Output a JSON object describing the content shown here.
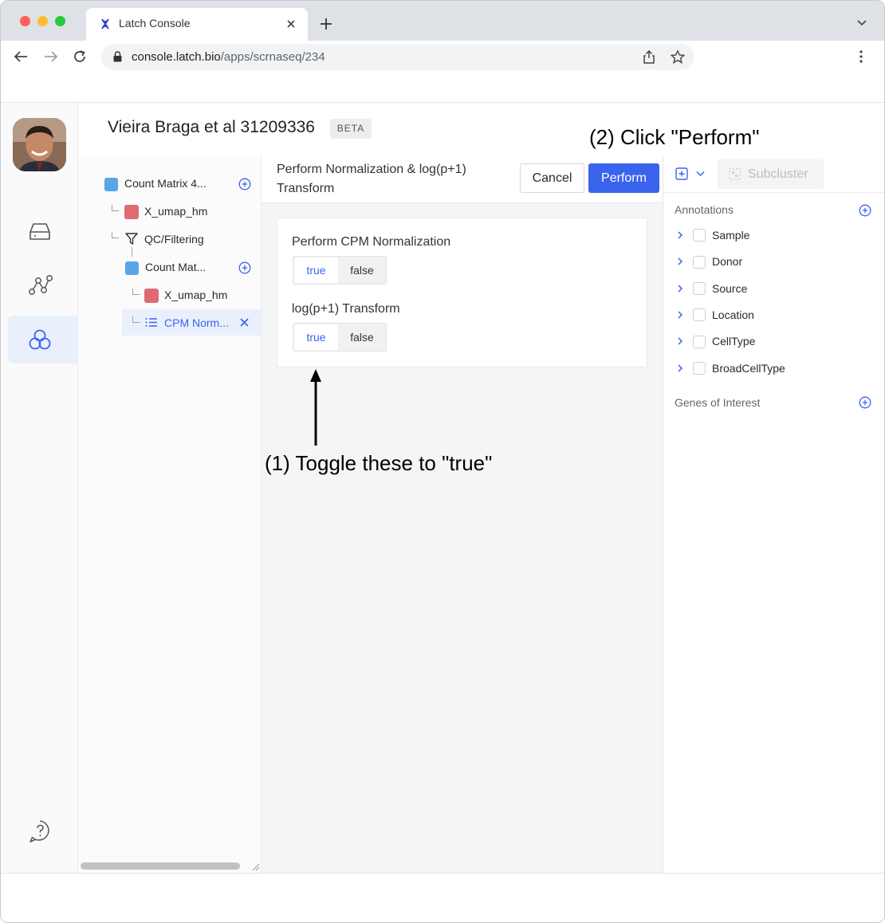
{
  "browser": {
    "tab_title": "Latch Console",
    "url_host": "console.latch.bio",
    "url_path": "/apps/scrnaseq/234"
  },
  "app": {
    "project_title": "Vieira Braga et al 31209336",
    "project_badge": "BETA"
  },
  "tree": {
    "items": [
      {
        "label": "Count Matrix 4...",
        "kind": "matrix"
      },
      {
        "label": "X_umap_hm",
        "kind": "embedding"
      },
      {
        "label": "QC/Filtering",
        "kind": "filter"
      },
      {
        "label": "Count Mat...",
        "kind": "matrix"
      },
      {
        "label": "X_umap_hm",
        "kind": "embedding"
      },
      {
        "label": "CPM Norm...",
        "kind": "operation",
        "selected": true
      }
    ]
  },
  "operation": {
    "title": "Perform Normalization & log(p+1) Transform",
    "cancel_label": "Cancel",
    "perform_label": "Perform",
    "fields": [
      {
        "label": "Perform CPM Normalization",
        "true_label": "true",
        "false_label": "false",
        "selected": "true"
      },
      {
        "label": "log(p+1) Transform",
        "true_label": "true",
        "false_label": "false",
        "selected": "true"
      }
    ]
  },
  "right_panel": {
    "subcluster_label": "Subcluster",
    "annotations_label": "Annotations",
    "annotations": [
      "Sample",
      "Donor",
      "Source",
      "Location",
      "CellType",
      "BroadCellType"
    ],
    "genes_label": "Genes of Interest"
  },
  "callouts": {
    "step1": "(1) Toggle these to \"true\"",
    "step2": "(2) Click \"Perform\""
  },
  "colors": {
    "accent": "#3a63ee",
    "matrix_node": "#5aa4e8",
    "embedding_node": "#e06a73",
    "selected_bg": "#eaf0fb"
  }
}
